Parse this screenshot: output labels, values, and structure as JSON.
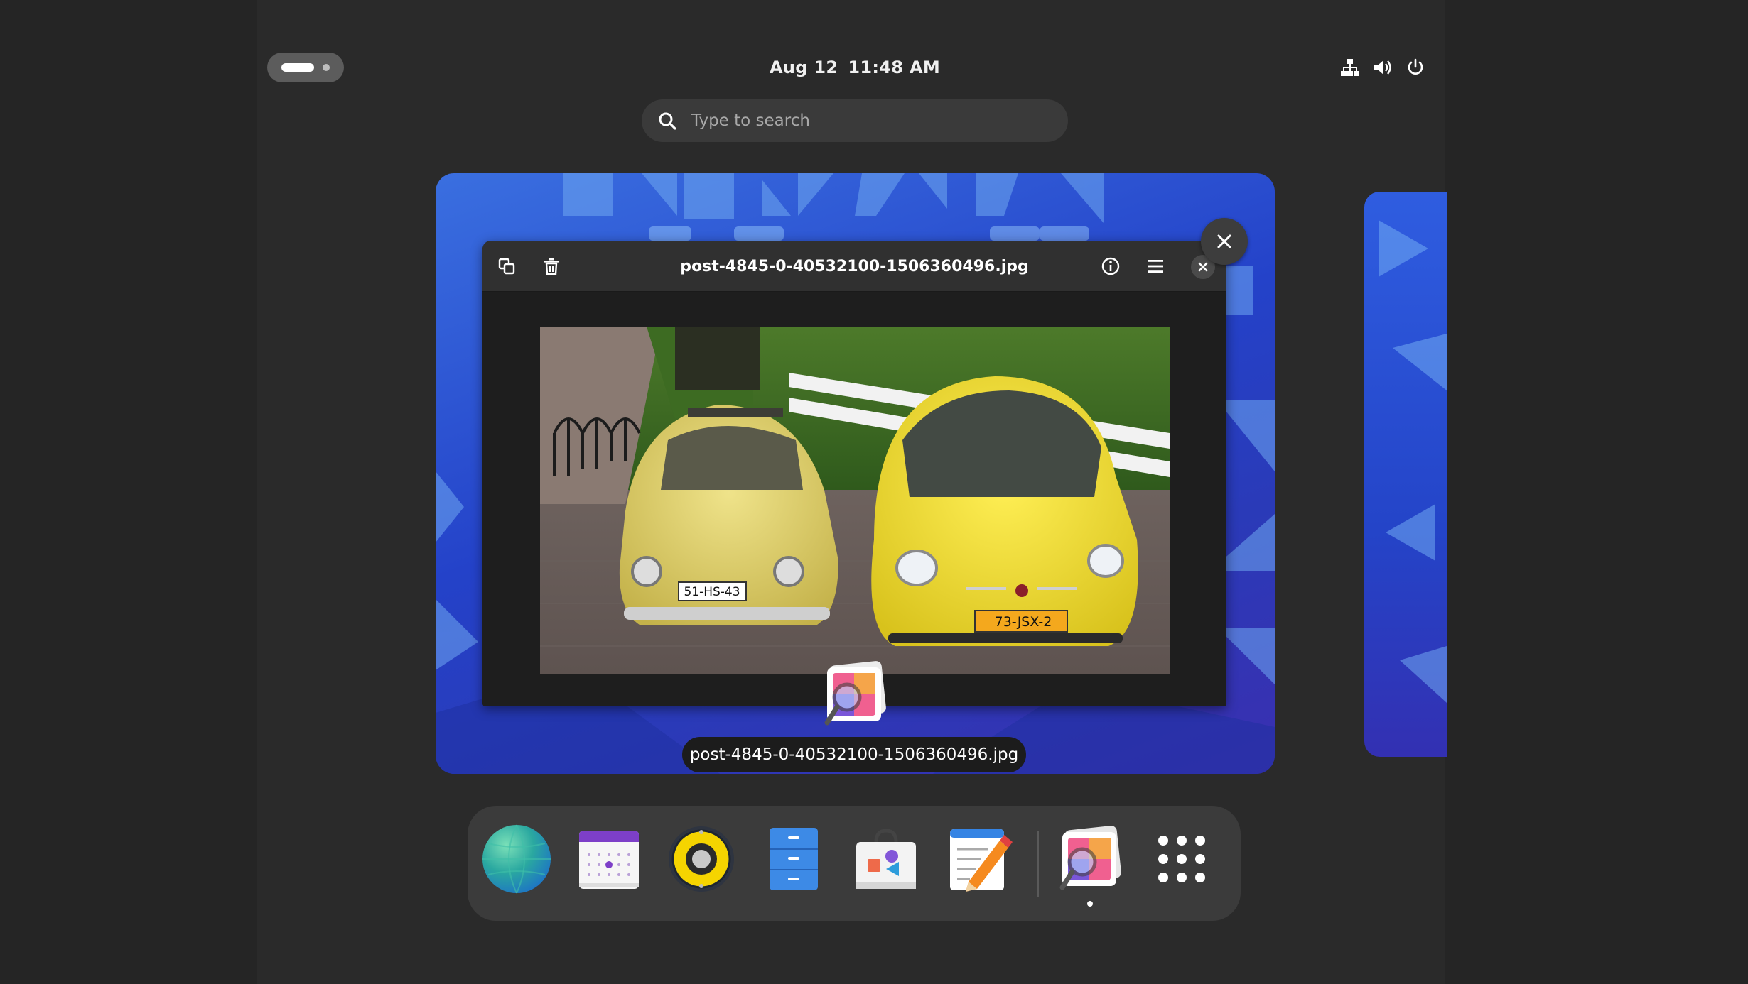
{
  "topbar": {
    "date": "Aug 12",
    "time": "11:48 AM",
    "tray_icons": [
      "network-icon",
      "volume-icon",
      "power-icon"
    ]
  },
  "search": {
    "placeholder": "Type to search"
  },
  "window": {
    "title": "post-4845-0-40532100-1506360496.jpg",
    "label": "post-4845-0-40532100-1506360496.jpg",
    "photo": {
      "plate_left": "51-HS-43",
      "plate_right": "73-JSX-2"
    }
  },
  "dock": {
    "apps": [
      "web-browser",
      "calendar",
      "rhythmbox",
      "file-manager",
      "software-center",
      "text-editor",
      "image-viewer",
      "show-apps"
    ]
  },
  "colors": {
    "background": "#242424",
    "wallpaper_blue": "#2442c9",
    "car_yellow": "#f2dc3c"
  }
}
